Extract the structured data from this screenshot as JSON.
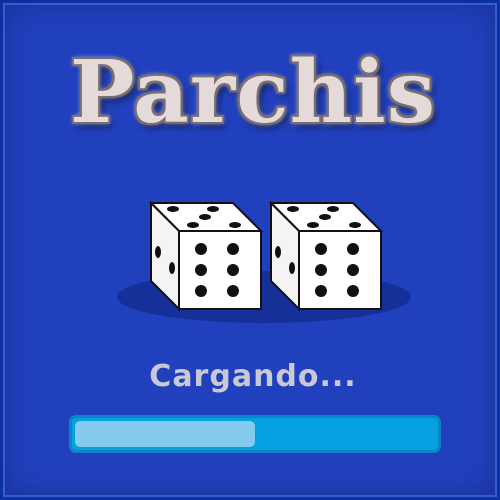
{
  "game": {
    "title": "Parchis"
  },
  "dice": [
    {
      "top_face": 5,
      "front_face": 6,
      "side_face": 2
    },
    {
      "top_face": 5,
      "front_face": 6,
      "side_face": 2
    }
  ],
  "loading": {
    "label": "Cargando...",
    "progress": 0.5
  },
  "colors": {
    "background": "#2140bd",
    "progress_track": "#069fe0",
    "progress_fill": "#84cbef",
    "title_text": "#e4dada"
  }
}
